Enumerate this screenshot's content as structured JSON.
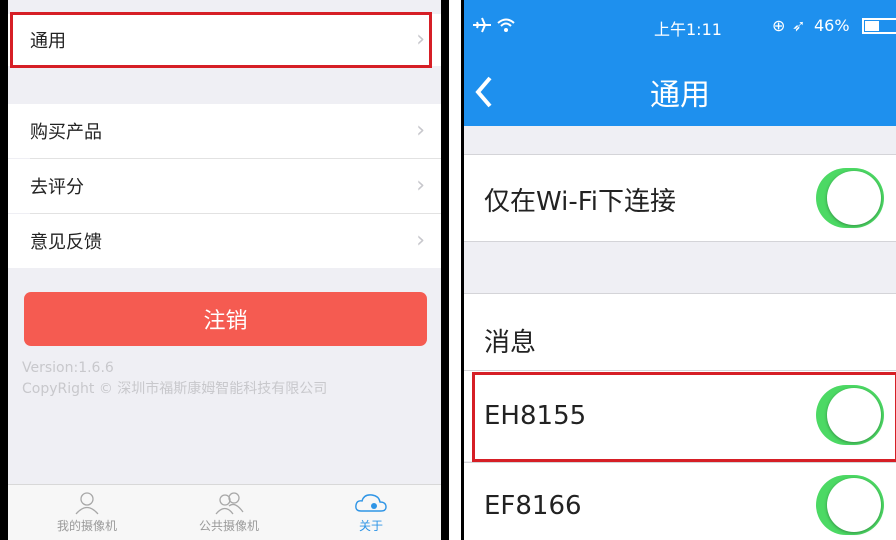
{
  "left": {
    "menu": [
      {
        "label": "通用"
      },
      {
        "label": "购买产品"
      },
      {
        "label": "去评分"
      },
      {
        "label": "意见反馈"
      }
    ],
    "logout_label": "注销",
    "version": "Version:1.6.6",
    "copyright": "CopyRight © 深圳市福斯康姆智能科技有限公司",
    "tabs": [
      {
        "label": "我的摄像机",
        "icon": "person-icon"
      },
      {
        "label": "公共摄像机",
        "icon": "people-icon"
      },
      {
        "label": "关于",
        "icon": "cloud-icon",
        "active": true
      }
    ],
    "accent": "#2f95e6",
    "logout_color": "#f55b51",
    "highlight_color": "#d61f26"
  },
  "right": {
    "status": {
      "time": "上午1:11",
      "battery": "46%"
    },
    "title": "通用",
    "wifi_only_label": "仅在Wi-Fi下连接",
    "section_label": "消息",
    "devices": [
      {
        "label": "EH8155",
        "on": true
      },
      {
        "label": "EF8166",
        "on": true
      }
    ],
    "bar_color": "#1e90ee",
    "toggle_color": "#4cd964"
  }
}
